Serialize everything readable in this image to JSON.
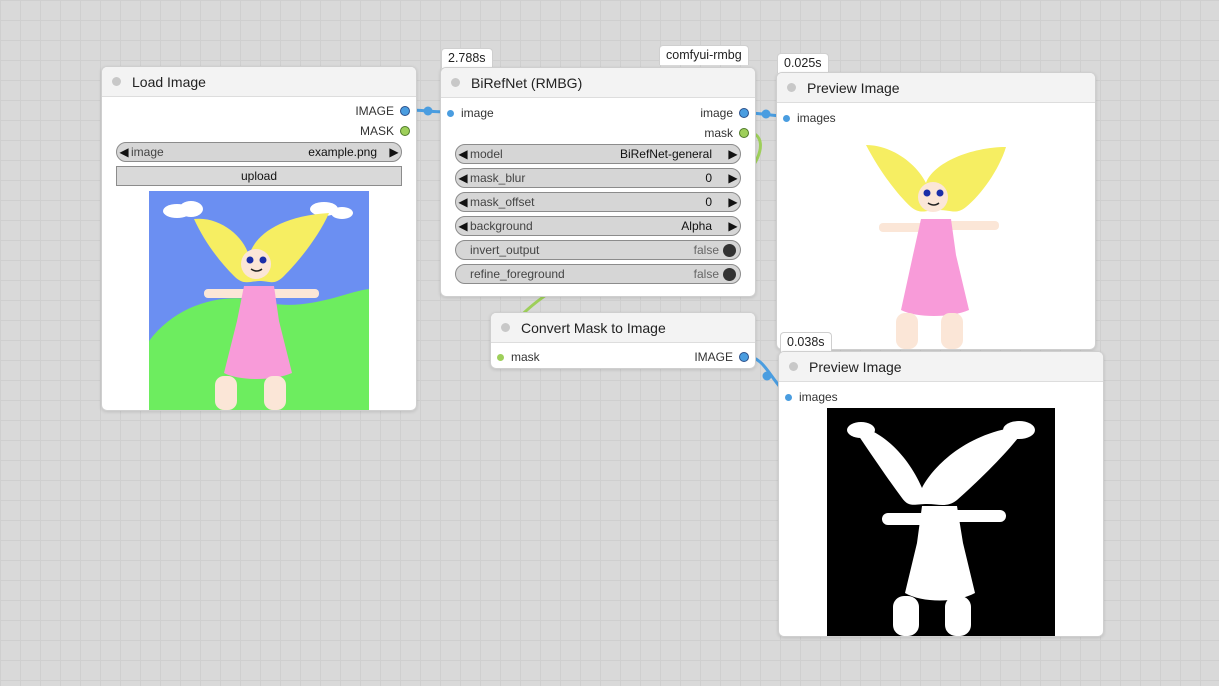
{
  "colors": {
    "image_link": "#4a9de0",
    "mask_link": "#9ecf5a",
    "canvas_bg": "#d9d9d9"
  },
  "load_image": {
    "title": "Load Image",
    "outputs": [
      "IMAGE",
      "MASK"
    ],
    "image_widget": {
      "label": "image",
      "value": "example.png"
    },
    "upload_label": "upload"
  },
  "birefnet": {
    "title": "BiRefNet (RMBG)",
    "time_badge": "2.788s",
    "pack_badge": "comfyui-rmbg",
    "input": "image",
    "outputs": [
      "image",
      "mask"
    ],
    "widgets": [
      {
        "label": "model",
        "value": "BiRefNet-general"
      },
      {
        "label": "mask_blur",
        "value": "0"
      },
      {
        "label": "mask_offset",
        "value": "0"
      },
      {
        "label": "background",
        "value": "Alpha"
      },
      {
        "label": "invert_output",
        "value": "false"
      },
      {
        "label": "refine_foreground",
        "value": "false"
      }
    ]
  },
  "convert_mask": {
    "title": "Convert Mask to Image",
    "input": "mask",
    "output": "IMAGE"
  },
  "preview_1": {
    "title": "Preview Image",
    "time_badge": "0.025s",
    "input": "images"
  },
  "preview_2": {
    "title": "Preview Image",
    "time_badge": "0.038s",
    "input": "images"
  }
}
